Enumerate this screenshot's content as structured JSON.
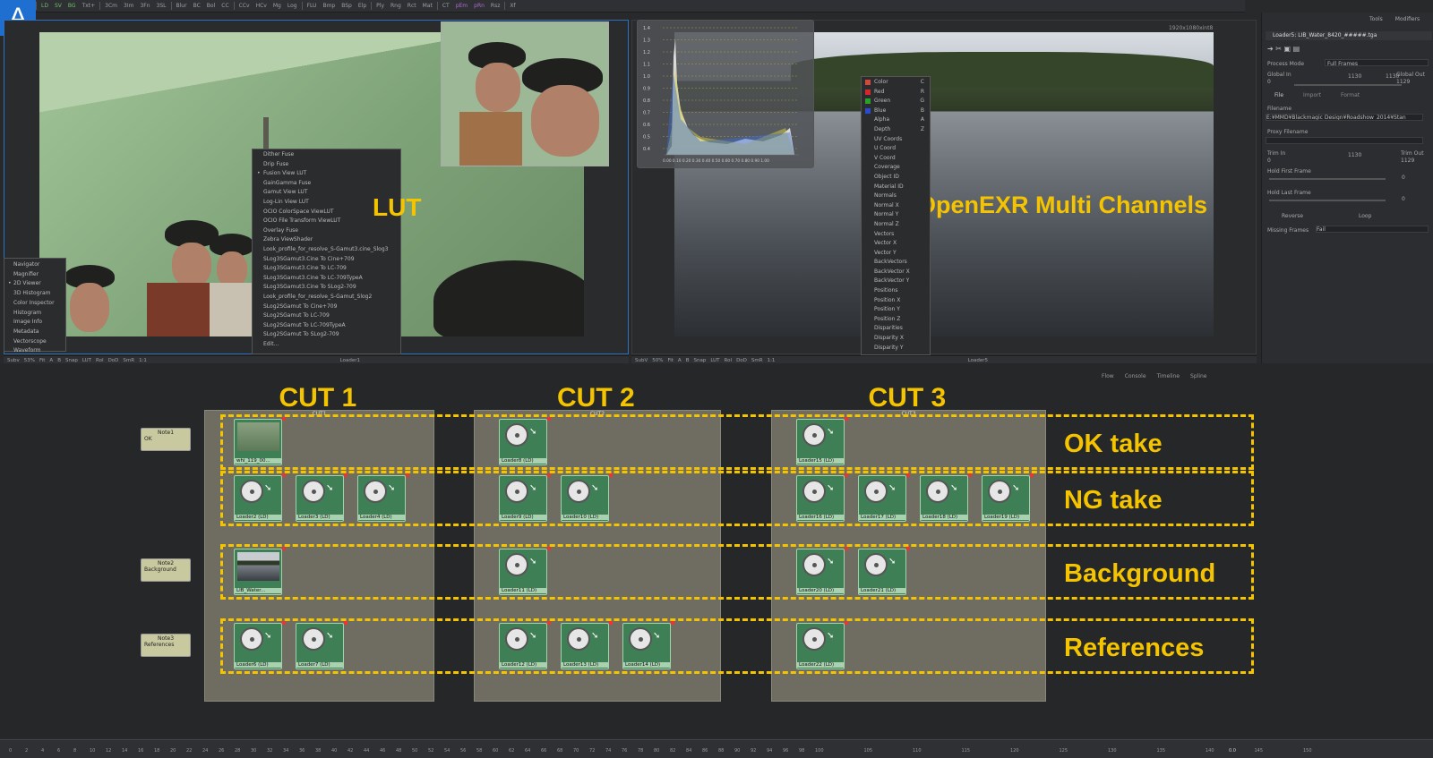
{
  "app": {
    "badge": "A"
  },
  "toolbar": {
    "items": [
      "LD",
      "SV",
      "BG",
      "Txt+",
      "3Cm",
      "3Im",
      "3Fn",
      "3SL",
      "Blur",
      "BC",
      "Bol",
      "CC",
      "CCv",
      "HCv",
      "Mg",
      "Log",
      "FLU",
      "Bmp",
      "BSp",
      "Elp",
      "Ply",
      "Rng",
      "Rct",
      "Mat",
      "CT",
      "pEm",
      "pRn",
      "Rsz",
      "Xf"
    ]
  },
  "viewer1": {
    "label": "LUT",
    "lut_menu": [
      "Dither Fuse",
      "Drip Fuse",
      "Fusion View LUT",
      "GainGamma Fuse",
      "Gamut View LUT",
      "Log-Lin View LUT",
      "OCIO ColorSpace ViewLUT",
      "OCIO File Transform ViewLUT",
      "Overlay Fuse",
      "Zebra ViewShader",
      "Look_profile_for_resolve_S-Gamut3.cine_Slog3",
      "SLog3SGamut3.Cine To Cine+709",
      "SLog3SGamut3.Cine To LC-709",
      "SLog3SGamut3.Cine To LC-709TypeA",
      "SLog3SGamut3.Cine To SLog2-709",
      "Look_profile_for_resolve_S-Gamut_Slog2",
      "SLog2SGamut To Cine+709",
      "SLog2SGamut To LC-709",
      "SLog2SGamut To LC-709TypeA",
      "SLog2SGamut To SLog2-709",
      "Edit..."
    ],
    "lut_checked": 2,
    "nav_menu": [
      "Navigator",
      "Magnifier",
      "2D Viewer",
      "3D Histogram",
      "Color Inspector",
      "Histogram",
      "Image Info",
      "Metadata",
      "Vectorscope",
      "Waveform"
    ],
    "nav_checked": 2,
    "toolbar": [
      "Subv",
      "53%",
      "Fit",
      "A",
      "B",
      "Snap",
      "LUT",
      "RoI",
      "DoD",
      "SmR",
      "1:1"
    ],
    "footer_name": "Loader1"
  },
  "viewer2": {
    "label": "OpenEXR Multi Channels",
    "resolution": "1920x1080xint8",
    "hist_y": [
      "1.4",
      "1.3",
      "1.2",
      "1.1",
      "1.0",
      "0.9",
      "0.8",
      "0.7",
      "0.6",
      "0.5",
      "0.4"
    ],
    "hist_x": "0.00 0.10 0.20 0.30 0.40 0.50 0.60 0.70 0.80 0.90 1.00",
    "channels": [
      {
        "label": "Color",
        "key": "C",
        "swatch": "#d04a3a"
      },
      {
        "label": "Red",
        "key": "R",
        "swatch": "#d02a2a"
      },
      {
        "label": "Green",
        "key": "G",
        "swatch": "#2aa02a"
      },
      {
        "label": "Blue",
        "key": "B",
        "swatch": "#2a4ad0"
      },
      {
        "label": "Alpha",
        "key": "A",
        "swatch": ""
      },
      {
        "label": "Depth",
        "key": "Z",
        "swatch": ""
      },
      {
        "label": "UV Coords",
        "key": "",
        "swatch": ""
      },
      {
        "label": "U Coord",
        "key": "",
        "swatch": ""
      },
      {
        "label": "V Coord",
        "key": "",
        "swatch": ""
      },
      {
        "label": "Coverage",
        "key": "",
        "swatch": ""
      },
      {
        "label": "Object ID",
        "key": "",
        "swatch": ""
      },
      {
        "label": "Material ID",
        "key": "",
        "swatch": ""
      },
      {
        "label": "Normals",
        "key": "",
        "swatch": ""
      },
      {
        "label": "Normal X",
        "key": "",
        "swatch": ""
      },
      {
        "label": "Normal Y",
        "key": "",
        "swatch": ""
      },
      {
        "label": "Normal Z",
        "key": "",
        "swatch": ""
      },
      {
        "label": "Vectors",
        "key": "",
        "swatch": ""
      },
      {
        "label": "Vector X",
        "key": "",
        "swatch": ""
      },
      {
        "label": "Vector Y",
        "key": "",
        "swatch": ""
      },
      {
        "label": "BackVectors",
        "key": "",
        "swatch": ""
      },
      {
        "label": "BackVector X",
        "key": "",
        "swatch": ""
      },
      {
        "label": "BackVector Y",
        "key": "",
        "swatch": ""
      },
      {
        "label": "Positions",
        "key": "",
        "swatch": ""
      },
      {
        "label": "Position X",
        "key": "",
        "swatch": ""
      },
      {
        "label": "Position Y",
        "key": "",
        "swatch": ""
      },
      {
        "label": "Position Z",
        "key": "",
        "swatch": ""
      },
      {
        "label": "Disparities",
        "key": "",
        "swatch": ""
      },
      {
        "label": "Disparity X",
        "key": "",
        "swatch": ""
      },
      {
        "label": "Disparity Y",
        "key": "",
        "swatch": ""
      }
    ],
    "toolbar": [
      "SubV",
      "50%",
      "Fit",
      "A",
      "B",
      "Snap",
      "LUT",
      "RoI",
      "DoD",
      "SmR",
      "1:1"
    ],
    "footer_name": "Loader5"
  },
  "panel": {
    "tabs": [
      "Tools",
      "Modifiers"
    ],
    "title": "Loader5: LIB_Water_8420_#####.tga",
    "process_mode_label": "Process Mode",
    "process_mode_value": "Full Frames",
    "global_in_label": "Global In",
    "global_in_value": "0",
    "global_out_label": "Global Out",
    "global_out_value": "1129",
    "global_mid": "1130",
    "global_mid2": "1130",
    "subtabs": [
      "File",
      "Import",
      "Format"
    ],
    "filename_label": "Filename",
    "filename_value": "E:¥MMD¥Blackmagic Design¥Roadshow_2014¥Stan",
    "proxy_label": "Proxy Filename",
    "trim_in_label": "Trim In",
    "trim_in_value": "0",
    "trim_out_label": "Trim Out",
    "trim_out_value": "1129",
    "trim_mid": "1130",
    "hold_first_label": "Hold First Frame",
    "hold_first_value": "0",
    "hold_last_label": "Hold Last Frame",
    "hold_last_value": "0",
    "reverse_label": "Reverse",
    "loop_label": "Loop",
    "missing_label": "Missing Frames",
    "missing_value": "Fail"
  },
  "flow": {
    "tabs": [
      "Flow",
      "Console",
      "Timeline",
      "Spline"
    ],
    "cuts": [
      {
        "title": "CUT 1",
        "label": "CUT1"
      },
      {
        "title": "CUT 2",
        "label": "CUT2"
      },
      {
        "title": "CUT 3",
        "label": "CUT3"
      }
    ],
    "rows": [
      "OK take",
      "NG take",
      "Background",
      "References"
    ],
    "notes": [
      {
        "title": "Note1",
        "body": "OK"
      },
      {
        "title": "Note2",
        "body": "Background"
      },
      {
        "title": "Note3",
        "body": "References"
      }
    ],
    "nodes": {
      "c1_ok": [
        "whi_119_00..."
      ],
      "c1_ng": [
        "Loader2 (LD)",
        "Loader3 (LD)",
        "Loader4 (LD)"
      ],
      "c1_bg": [
        "LIB_Water..."
      ],
      "c1_ref": [
        "Loader6 (LD)",
        "Loader7 (LD)"
      ],
      "c2_ok": [
        "Loader8 (LD)"
      ],
      "c2_ng": [
        "Loader9 (LD)",
        "Loader10 (LD)"
      ],
      "c2_bg": [
        "Loader11 (LD)"
      ],
      "c2_ref": [
        "Loader12 (LD)",
        "Loader13 (LD)",
        "Loader14 (LD)"
      ],
      "c3_ok": [
        "Loader15 (LD)"
      ],
      "c3_ng": [
        "Loader16 (LD)",
        "Loader17 (LD)",
        "Loader18 (LD)",
        "Loader19 (LD)"
      ],
      "c3_bg": [
        "Loader20 (LD)",
        "Loader21 (LD)"
      ],
      "c3_ref": [
        "Loader22 (LD)"
      ]
    }
  },
  "ruler": {
    "ticks": [
      "0",
      "2",
      "4",
      "6",
      "8",
      "10",
      "12",
      "14",
      "16",
      "18",
      "20",
      "22",
      "24",
      "26",
      "28",
      "30",
      "32",
      "34",
      "36",
      "38",
      "40",
      "42",
      "44",
      "46",
      "48",
      "50",
      "52",
      "54",
      "56",
      "58",
      "60",
      "62",
      "64",
      "66",
      "68",
      "70",
      "72",
      "74",
      "76",
      "78",
      "80",
      "82",
      "84",
      "86",
      "88",
      "90",
      "92",
      "94",
      "96",
      "98",
      "100",
      "105",
      "110",
      "115",
      "120",
      "125",
      "130",
      "135",
      "140",
      "145",
      "150"
    ],
    "current": "0.0"
  }
}
